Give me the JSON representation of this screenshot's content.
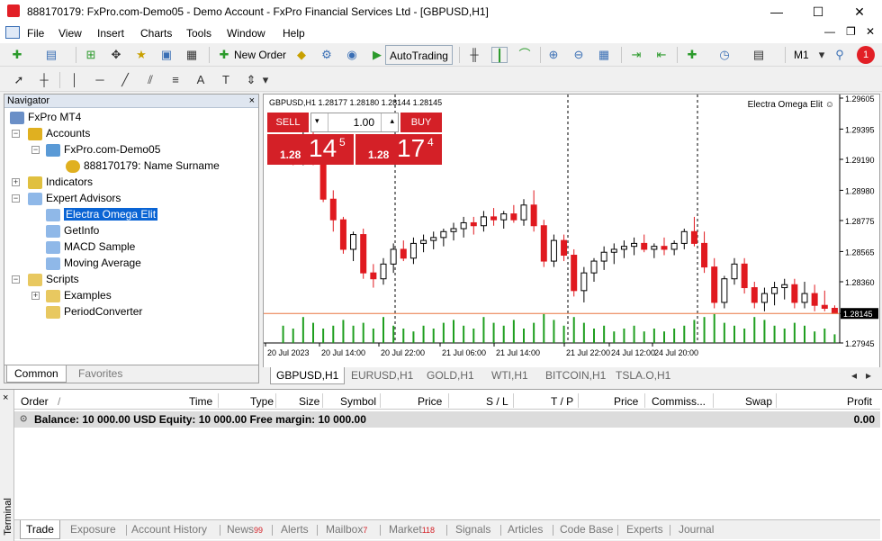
{
  "window": {
    "title": "888170179: FxPro.com-Demo05 - Demo Account - FxPro Financial Services Ltd - [GBPUSD,H1]",
    "minimize": "—",
    "maximize": "☐",
    "close": "✕"
  },
  "menu": [
    "File",
    "View",
    "Insert",
    "Charts",
    "Tools",
    "Window",
    "Help"
  ],
  "menu_right": [
    "—",
    "❐",
    "✕"
  ],
  "toolbar": {
    "new_order": "New Order",
    "auto_trading": "AutoTrading",
    "timeframe": "M1",
    "notification_count": "1"
  },
  "navigator": {
    "title": "Navigator",
    "close": "×",
    "root": "FxPro MT4",
    "accounts": "Accounts",
    "server": "FxPro.com-Demo05",
    "account": "888170179: Name Surname",
    "indicators": "Indicators",
    "expert_advisors": "Expert Advisors",
    "experts": [
      "Electra Omega Elit",
      "GetInfo",
      "MACD Sample",
      "Moving Average"
    ],
    "scripts": "Scripts",
    "script_items": [
      "Examples",
      "PeriodConverter"
    ],
    "tabs": [
      "Common",
      "Favorites"
    ]
  },
  "chart": {
    "symbol_info": "GBPUSD,H1  1.28177 1.28180 1.28144 1.28145",
    "ea_label": "Electra Omega Elit ☺",
    "current_price": "1.28145",
    "sell_label": "SELL",
    "buy_label": "BUY",
    "volume": "1.00",
    "sell_price": {
      "prefix": "1.28",
      "big": "14",
      "sup": "5"
    },
    "buy_price": {
      "prefix": "1.28",
      "big": "17",
      "sup": "4"
    },
    "price_axis": [
      "1.29605",
      "1.29395",
      "1.29190",
      "1.28980",
      "1.28775",
      "1.28565",
      "1.28360",
      "1.28145",
      "1.27945"
    ],
    "time_axis": [
      "20 Jul 2023",
      "20 Jul 14:00",
      "20 Jul 22:00",
      "21 Jul 06:00",
      "21 Jul 14:00",
      "21 Jul 22:00",
      "24 Jul 12:00",
      "24 Jul 20:00"
    ]
  },
  "chart_data": {
    "type": "candlestick",
    "symbol": "GBPUSD",
    "timeframe": "H1",
    "ylim": [
      1.27945,
      1.29605
    ],
    "current_price": 1.28145,
    "candles": [
      [
        1.2928,
        1.2931,
        1.292,
        1.2924
      ],
      [
        1.2924,
        1.2932,
        1.2915,
        1.2918
      ],
      [
        1.2918,
        1.294,
        1.2915,
        1.2935
      ],
      [
        1.2935,
        1.2938,
        1.2915,
        1.2918
      ],
      [
        1.2918,
        1.2922,
        1.289,
        1.2892
      ],
      [
        1.2892,
        1.2898,
        1.287,
        1.2878
      ],
      [
        1.2878,
        1.288,
        1.2855,
        1.2858
      ],
      [
        1.2858,
        1.287,
        1.285,
        1.2868
      ],
      [
        1.2868,
        1.2872,
        1.2838,
        1.2842
      ],
      [
        1.2842,
        1.2848,
        1.2832,
        1.2838
      ],
      [
        1.2838,
        1.2852,
        1.2834,
        1.2848
      ],
      [
        1.2848,
        1.2862,
        1.2842,
        1.2858
      ],
      [
        1.2858,
        1.2864,
        1.285,
        1.2852
      ],
      [
        1.2852,
        1.2866,
        1.2848,
        1.2862
      ],
      [
        1.2862,
        1.2868,
        1.2856,
        1.2864
      ],
      [
        1.2864,
        1.287,
        1.2858,
        1.2866
      ],
      [
        1.2866,
        1.2872,
        1.286,
        1.287
      ],
      [
        1.287,
        1.2876,
        1.2864,
        1.2872
      ],
      [
        1.2872,
        1.288,
        1.2866,
        1.2876
      ],
      [
        1.2876,
        1.288,
        1.2868,
        1.2874
      ],
      [
        1.2874,
        1.2884,
        1.287,
        1.288
      ],
      [
        1.288,
        1.2886,
        1.2874,
        1.2878
      ],
      [
        1.2878,
        1.2884,
        1.2872,
        1.2882
      ],
      [
        1.2882,
        1.2888,
        1.2876,
        1.2878
      ],
      [
        1.2878,
        1.2892,
        1.2874,
        1.2888
      ],
      [
        1.2888,
        1.2898,
        1.287,
        1.2874
      ],
      [
        1.2874,
        1.2878,
        1.2846,
        1.285
      ],
      [
        1.285,
        1.2868,
        1.2846,
        1.2864
      ],
      [
        1.2864,
        1.2868,
        1.285,
        1.2854
      ],
      [
        1.2854,
        1.2858,
        1.2826,
        1.283
      ],
      [
        1.283,
        1.2846,
        1.2822,
        1.2842
      ],
      [
        1.2842,
        1.2852,
        1.2836,
        1.285
      ],
      [
        1.285,
        1.286,
        1.2844,
        1.2856
      ],
      [
        1.2856,
        1.2862,
        1.2848,
        1.2858
      ],
      [
        1.2858,
        1.2864,
        1.2852,
        1.286
      ],
      [
        1.286,
        1.2866,
        1.2854,
        1.2862
      ],
      [
        1.2862,
        1.2868,
        1.2856,
        1.2858
      ],
      [
        1.2858,
        1.2862,
        1.2852,
        1.286
      ],
      [
        1.286,
        1.2866,
        1.2854,
        1.2858
      ],
      [
        1.2858,
        1.2864,
        1.2854,
        1.2862
      ],
      [
        1.2862,
        1.2872,
        1.2858,
        1.287
      ],
      [
        1.287,
        1.288,
        1.286,
        1.2862
      ],
      [
        1.2862,
        1.287,
        1.2842,
        1.2846
      ],
      [
        1.2846,
        1.2852,
        1.2818,
        1.2822
      ],
      [
        1.2822,
        1.284,
        1.2818,
        1.2838
      ],
      [
        1.2838,
        1.2852,
        1.2834,
        1.2848
      ],
      [
        1.2848,
        1.2852,
        1.2828,
        1.2832
      ],
      [
        1.2832,
        1.2836,
        1.2818,
        1.2822
      ],
      [
        1.2822,
        1.2832,
        1.2816,
        1.2828
      ],
      [
        1.2828,
        1.2836,
        1.282,
        1.2832
      ],
      [
        1.2832,
        1.2838,
        1.2824,
        1.2834
      ],
      [
        1.2834,
        1.2838,
        1.2818,
        1.2822
      ],
      [
        1.2822,
        1.2836,
        1.2818,
        1.2828
      ],
      [
        1.2828,
        1.2834,
        1.2816,
        1.282
      ],
      [
        1.282,
        1.283,
        1.2816,
        1.2818
      ],
      [
        1.2818,
        1.282,
        1.28144,
        1.28145
      ]
    ],
    "volumes": [
      6,
      5,
      9,
      7,
      5,
      6,
      8,
      6,
      7,
      5,
      9,
      6,
      5,
      4,
      6,
      5,
      7,
      8,
      6,
      5,
      9,
      7,
      6,
      8,
      5,
      7,
      10,
      8,
      6,
      9,
      7,
      5,
      6,
      4,
      5,
      6,
      4,
      5,
      4,
      5,
      6,
      8,
      9,
      10,
      7,
      6,
      5,
      9,
      8,
      6,
      5,
      7,
      6,
      4,
      5,
      3
    ],
    "period_separators": [
      "20 Jul 22:00",
      "21 Jul 22:00",
      "24 Jul 20:00"
    ]
  },
  "chart_tabs": [
    "GBPUSD,H1",
    "EURUSD,H1",
    "GOLD,H1",
    "WTI,H1",
    "BITCOIN,H1",
    "TSLA.O,H1"
  ],
  "terminal": {
    "side_label": "Terminal",
    "close": "×",
    "columns": [
      "Order",
      "/",
      "Time",
      "Type",
      "Size",
      "Symbol",
      "Price",
      "S / L",
      "T / P",
      "Price",
      "Commiss...",
      "Swap",
      "Profit"
    ],
    "balance_text": "Balance: 10 000.00 USD  Equity: 10 000.00  Free margin: 10 000.00",
    "profit_total": "0.00",
    "tabs": [
      {
        "label": "Trade",
        "badge": ""
      },
      {
        "label": "Exposure",
        "badge": ""
      },
      {
        "label": "Account History",
        "badge": ""
      },
      {
        "label": "News",
        "badge": "99"
      },
      {
        "label": "Alerts",
        "badge": ""
      },
      {
        "label": "Mailbox",
        "badge": "7"
      },
      {
        "label": "Market",
        "badge": "118"
      },
      {
        "label": "Signals",
        "badge": ""
      },
      {
        "label": "Articles",
        "badge": ""
      },
      {
        "label": "Code Base",
        "badge": ""
      },
      {
        "label": "Experts",
        "badge": ""
      },
      {
        "label": "Journal",
        "badge": ""
      }
    ]
  },
  "colors": {
    "bear": "#e0191f",
    "bull": "#000000",
    "volume": "#1f9e1f",
    "price_line": "#e87540",
    "accent": "#d42027",
    "selection": "#0a64d4"
  }
}
